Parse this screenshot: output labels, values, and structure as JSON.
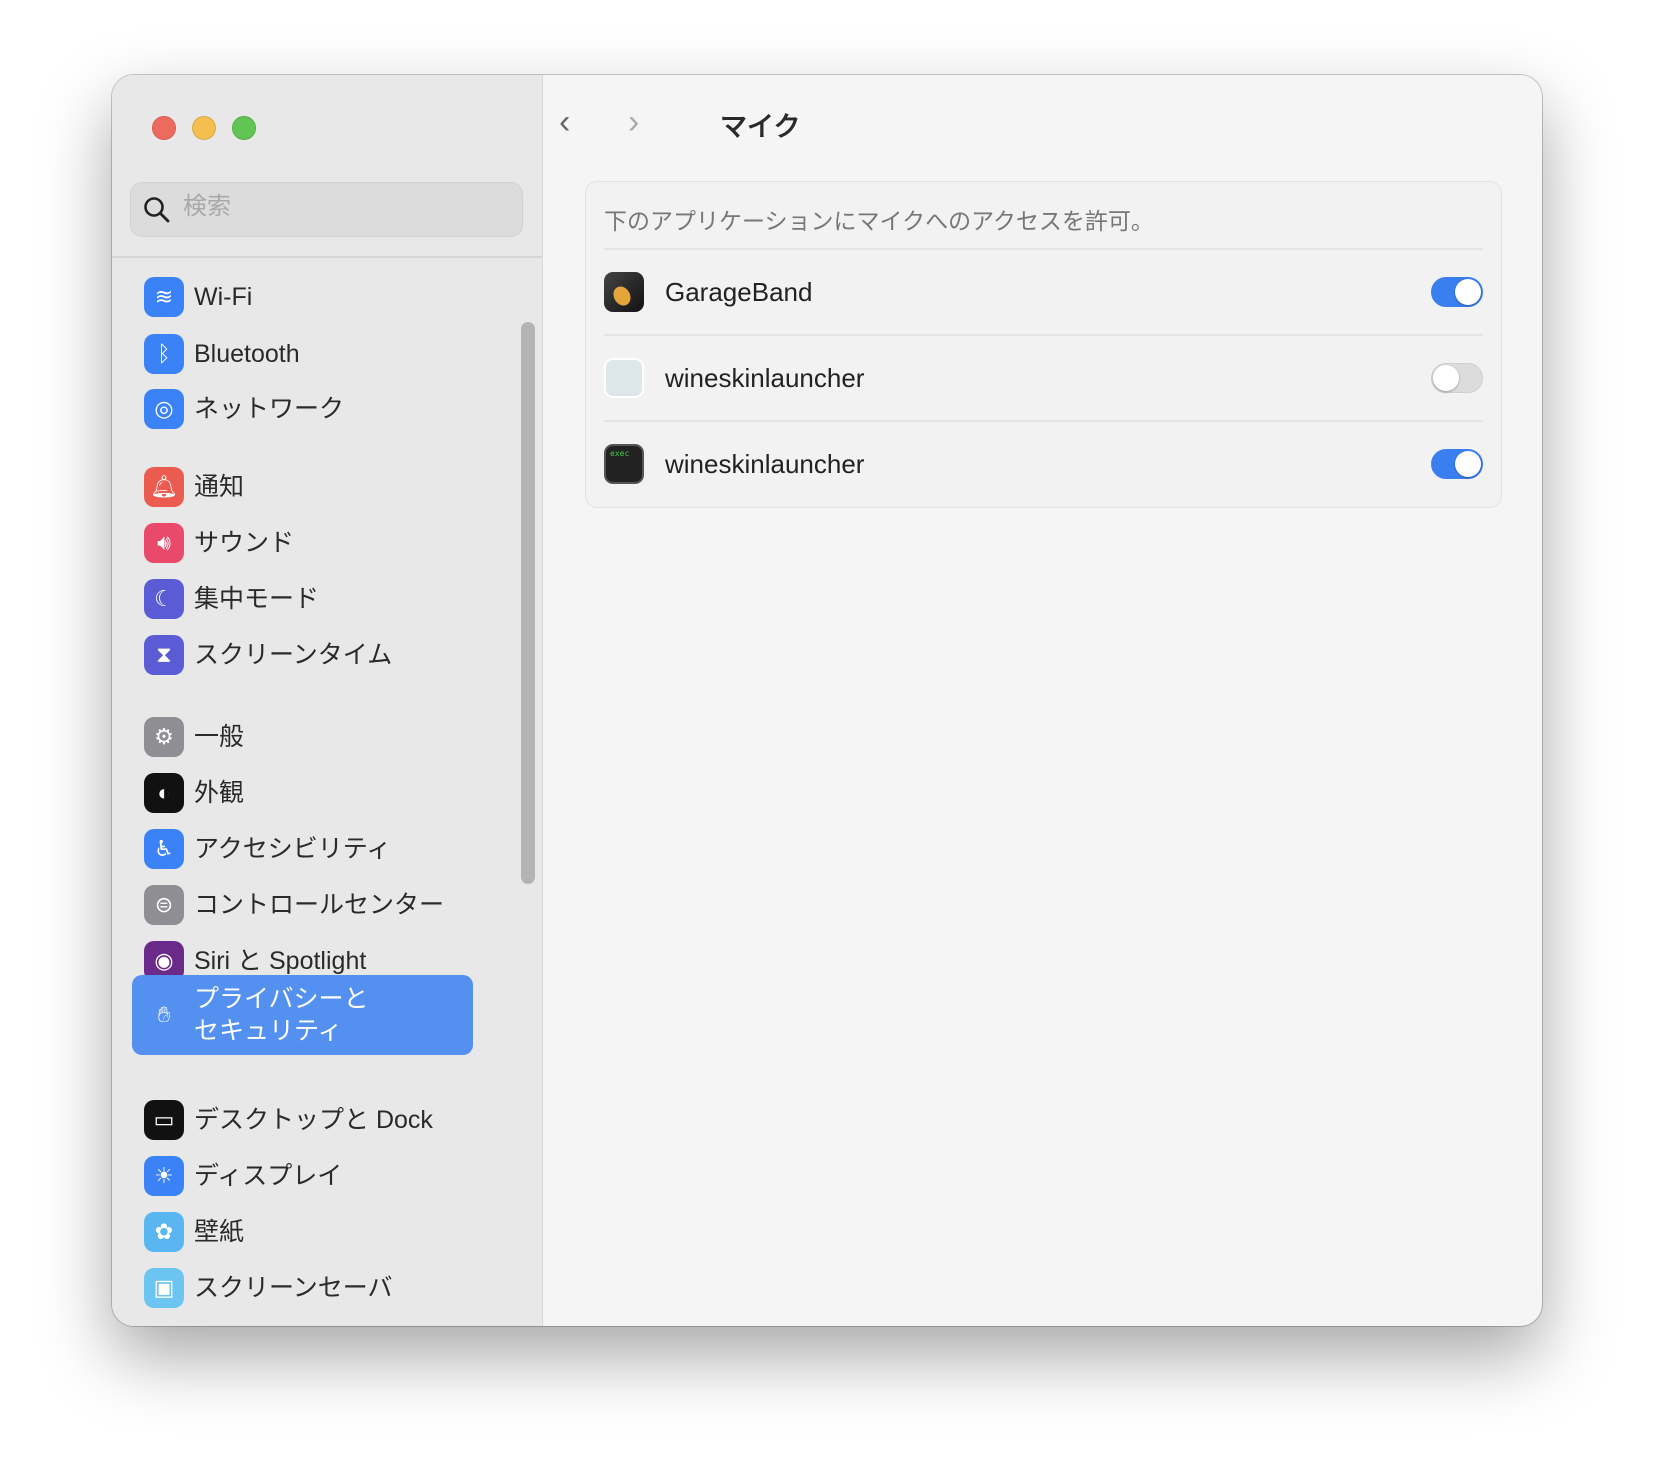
{
  "search": {
    "placeholder": "検索"
  },
  "sidebar": {
    "items": [
      {
        "label": "Wi-Fi",
        "icon": "wifi-icon",
        "color": "#3b82f6"
      },
      {
        "label": "Bluetooth",
        "icon": "bluetooth-icon",
        "color": "#3b82f6"
      },
      {
        "label": "ネットワーク",
        "icon": "globe-icon",
        "color": "#3b82f6"
      },
      {
        "label": "通知",
        "icon": "bell-icon",
        "color": "#ec5b4f"
      },
      {
        "label": "サウンド",
        "icon": "speaker-icon",
        "color": "#e9496a"
      },
      {
        "label": "集中モード",
        "icon": "moon-icon",
        "color": "#5b5bd6"
      },
      {
        "label": "スクリーンタイム",
        "icon": "hourglass-icon",
        "color": "#5b5bd6"
      },
      {
        "label": "一般",
        "icon": "gear-icon",
        "color": "#8e8e93"
      },
      {
        "label": "外観",
        "icon": "appearance-icon",
        "color": "#111111"
      },
      {
        "label": "アクセシビリティ",
        "icon": "accessibility-icon",
        "color": "#3b82f6"
      },
      {
        "label": "コントロールセンター",
        "icon": "switches-icon",
        "color": "#8e8e93"
      },
      {
        "label": "Siri と Spotlight",
        "icon": "siri-icon",
        "color": "#6a2a8a"
      },
      {
        "label": "プライバシーと\nセキュリティ",
        "icon": "hand-icon",
        "color": "#3b82f6",
        "selected": true
      },
      {
        "label": "デスクトップと Dock",
        "icon": "dock-icon",
        "color": "#111111"
      },
      {
        "label": "ディスプレイ",
        "icon": "sun-icon",
        "color": "#3b82f6"
      },
      {
        "label": "壁紙",
        "icon": "flower-icon",
        "color": "#5ab6f0"
      },
      {
        "label": "スクリーンセーバ",
        "icon": "screensaver-icon",
        "color": "#6cc4f0"
      }
    ]
  },
  "header": {
    "title": "マイク",
    "back": "‹",
    "forward": "›"
  },
  "panel": {
    "description": "下のアプリケーションにマイクへのアクセスを許可。",
    "apps": [
      {
        "name": "GarageBand",
        "enabled": true
      },
      {
        "name": "wineskinlauncher",
        "enabled": false
      },
      {
        "name": "wineskinlauncher",
        "enabled": true
      }
    ]
  }
}
